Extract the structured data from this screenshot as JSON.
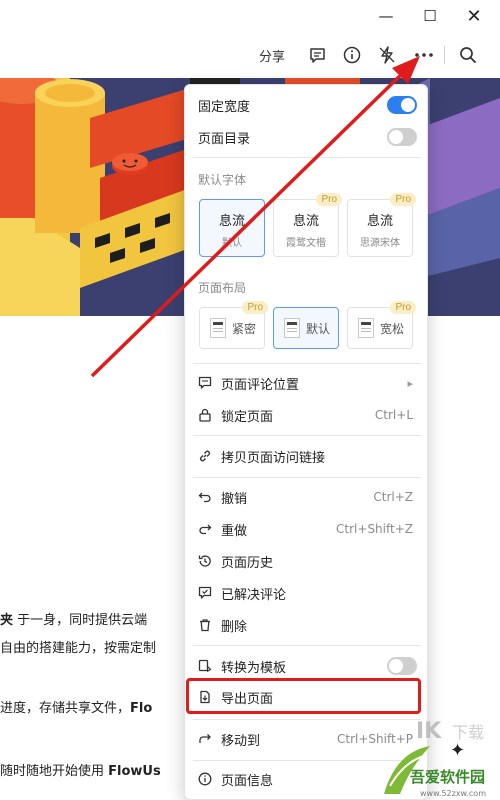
{
  "window": {
    "min": "—",
    "max": "☐",
    "close": "✕"
  },
  "toolbar": {
    "share": "分享"
  },
  "doc": {
    "line1_bold": "夹",
    "line1_rest": " 于一身，同时提供云端",
    "line2": "自由的搭建能力，按需定制",
    "line3": "进度，存储共享文件，",
    "line3_bold": "Flo",
    "line4": "随时随地开始使用 ",
    "line4_bold": "FlowUs"
  },
  "menu": {
    "fixed_width": "固定宽度",
    "page_toc": "页面目录",
    "default_font_header": "默认字体",
    "fonts": [
      {
        "title": "息流",
        "sub": "默认",
        "pro": ""
      },
      {
        "title": "息流",
        "sub": "霞鹜文楷",
        "pro": "Pro"
      },
      {
        "title": "息流",
        "sub": "思源宋体",
        "pro": "Pro"
      }
    ],
    "layout_header": "页面布局",
    "layouts": [
      {
        "label": "紧密",
        "pro": "Pro"
      },
      {
        "label": "默认",
        "pro": ""
      },
      {
        "label": "宽松",
        "pro": "Pro"
      }
    ],
    "comment_position": "页面评论位置",
    "lock_page": "锁定页面",
    "lock_shortcut": "Ctrl+L",
    "copy_link": "拷贝页面访问链接",
    "undo": "撤销",
    "undo_shortcut": "Ctrl+Z",
    "redo": "重做",
    "redo_shortcut": "Ctrl+Shift+Z",
    "history": "页面历史",
    "resolved_comments": "已解决评论",
    "delete": "删除",
    "convert_template": "转换为模板",
    "export_page": "导出页面",
    "move_to": "移动到",
    "move_shortcut": "Ctrl+Shift+P",
    "page_info": "页面信息"
  },
  "toggles": {
    "fixed_width": true,
    "page_toc": false,
    "convert_template": false
  },
  "colors": {
    "accent": "#2b7ff0",
    "annotation": "#e01b1b",
    "pro_badge": "#fbeec4"
  },
  "watermark": {
    "brand": "吾爱软件园",
    "url": "www.52zxw.com"
  }
}
